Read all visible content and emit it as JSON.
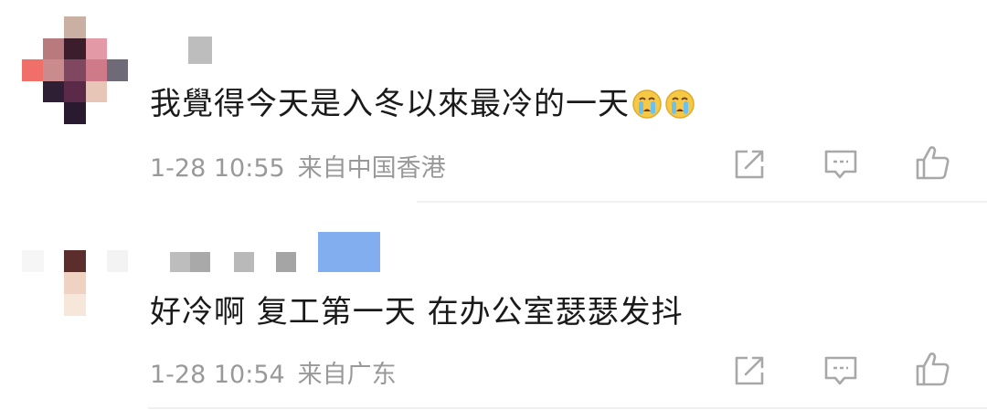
{
  "comments": [
    {
      "text": "我覺得今天是入冬以來最冷的一天",
      "emojis": [
        "crying-face",
        "crying-face"
      ],
      "time": "1-28 10:55",
      "location": "来自中国香港"
    },
    {
      "text": "好冷啊 复工第一天 在办公室瑟瑟发抖",
      "emojis": [],
      "time": "1-28 10:54",
      "location": "来自广东"
    }
  ],
  "actions": {
    "share_icon": "share-icon",
    "comment_icon": "comment-icon",
    "like_icon": "thumbs-up-icon",
    "icon_color": "#a8a8a8"
  },
  "colors": {
    "text": "#1a1a1a",
    "meta": "#999999",
    "divider": "#f0f0f0"
  }
}
